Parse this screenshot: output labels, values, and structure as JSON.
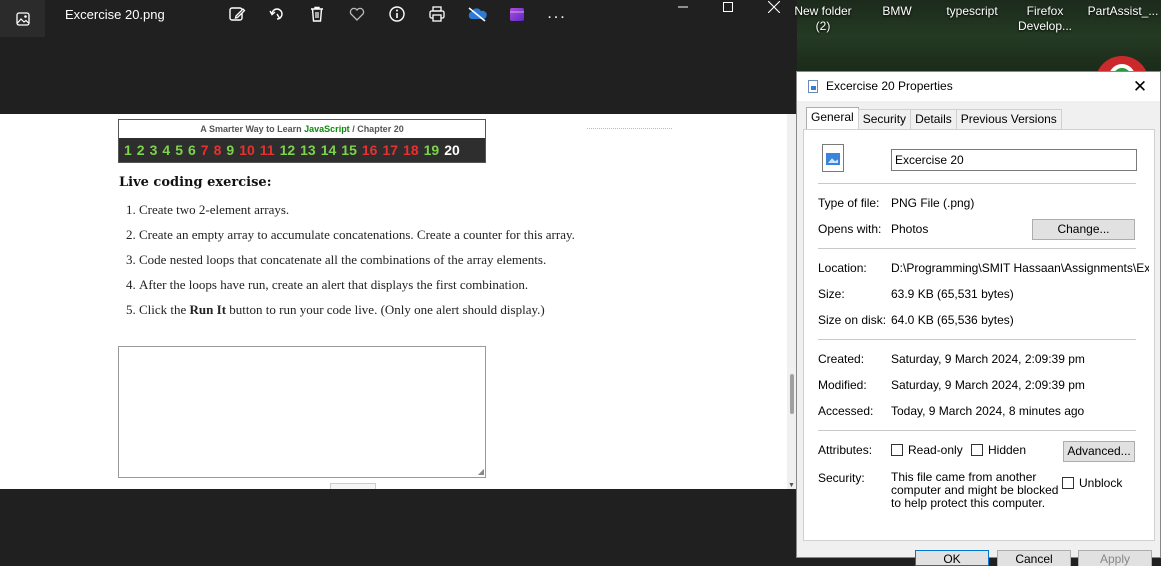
{
  "viewer": {
    "file_name": "Excercise 20.png",
    "toolbar": {
      "icons": [
        "edit-image-icon",
        "rotate-icon",
        "delete-icon",
        "favorite-icon",
        "info-icon",
        "print-icon",
        "onedrive-icon",
        "clipchamp-icon",
        "more-icon"
      ],
      "more_label": "..."
    },
    "window_controls": [
      "minimize",
      "maximize",
      "close"
    ]
  },
  "image_content": {
    "banner": {
      "prefix": "A Smarter Way to Learn ",
      "brand": "JavaScript",
      "suffix": "  /  Chapter 20",
      "numbers": [
        {
          "n": "1",
          "color": "#7bd44a"
        },
        {
          "n": "2",
          "color": "#7bd44a"
        },
        {
          "n": "3",
          "color": "#7bd44a"
        },
        {
          "n": "4",
          "color": "#7bd44a"
        },
        {
          "n": "5",
          "color": "#7bd44a"
        },
        {
          "n": "6",
          "color": "#7bd44a"
        },
        {
          "n": "7",
          "color": "#e83030"
        },
        {
          "n": "8",
          "color": "#e83030"
        },
        {
          "n": "9",
          "color": "#7bd44a"
        },
        {
          "n": "10",
          "color": "#e83030"
        },
        {
          "n": "11",
          "color": "#e83030"
        },
        {
          "n": "12",
          "color": "#7bd44a"
        },
        {
          "n": "13",
          "color": "#7bd44a"
        },
        {
          "n": "14",
          "color": "#7bd44a"
        },
        {
          "n": "15",
          "color": "#7bd44a"
        },
        {
          "n": "16",
          "color": "#e83030"
        },
        {
          "n": "17",
          "color": "#e83030"
        },
        {
          "n": "18",
          "color": "#e83030"
        },
        {
          "n": "19",
          "color": "#7bd44a"
        },
        {
          "n": "20",
          "color": "#ffffff"
        }
      ]
    },
    "heading": "Live coding exercise:",
    "steps": [
      {
        "num": "1.",
        "text": "Create two 2-element arrays."
      },
      {
        "num": "2.",
        "text": "Create an empty array to accumulate concatenations. Create a counter for this array."
      },
      {
        "num": "3.",
        "text": "Code nested loops that concatenate all the combinations of the array elements."
      },
      {
        "num": "4.",
        "text": "After the loops have run, create an alert that displays the first combination."
      },
      {
        "num": "5.",
        "pre": "Click the ",
        "bold": "Run It",
        "post": " button to run your code live. (Only one alert should display.)"
      }
    ]
  },
  "desktop": {
    "items": [
      {
        "label": "New folder\n(2)"
      },
      {
        "label": "BMW"
      },
      {
        "label": "typescript"
      },
      {
        "label": "Firefox\nDevelop..."
      },
      {
        "label": "PartAssist_..."
      }
    ]
  },
  "dialog": {
    "title": "Excercise 20 Properties",
    "close": "✕",
    "tabs": [
      "General",
      "Security",
      "Details",
      "Previous Versions"
    ],
    "file_name": "Excercise 20",
    "type_label": "Type of file:",
    "type_value": "PNG File (.png)",
    "opens_label": "Opens with:",
    "opens_value": "Photos",
    "change_button": "Change...",
    "location_label": "Location:",
    "location_value": "D:\\Programming\\SMIT Hassaan\\Assignments\\Exce",
    "size_label": "Size:",
    "size_value": "63.9 KB (65,531 bytes)",
    "size_disk_label": "Size on disk:",
    "size_disk_value": "64.0 KB (65,536 bytes)",
    "created_label": "Created:",
    "created_value": "Saturday, 9 March 2024, 2:09:39 pm",
    "modified_label": "Modified:",
    "modified_value": "Saturday, 9 March 2024, 2:09:39 pm",
    "accessed_label": "Accessed:",
    "accessed_value": "Today, 9 March 2024, 8 minutes ago",
    "attributes_label": "Attributes:",
    "readonly_label": "Read-only",
    "hidden_label": "Hidden",
    "advanced_button": "Advanced...",
    "security_label": "Security:",
    "security_text": "This file came from another computer and might be blocked to help protect this computer.",
    "unblock_label": "Unblock",
    "ok_button": "OK",
    "cancel_button": "Cancel",
    "apply_button": "Apply"
  }
}
